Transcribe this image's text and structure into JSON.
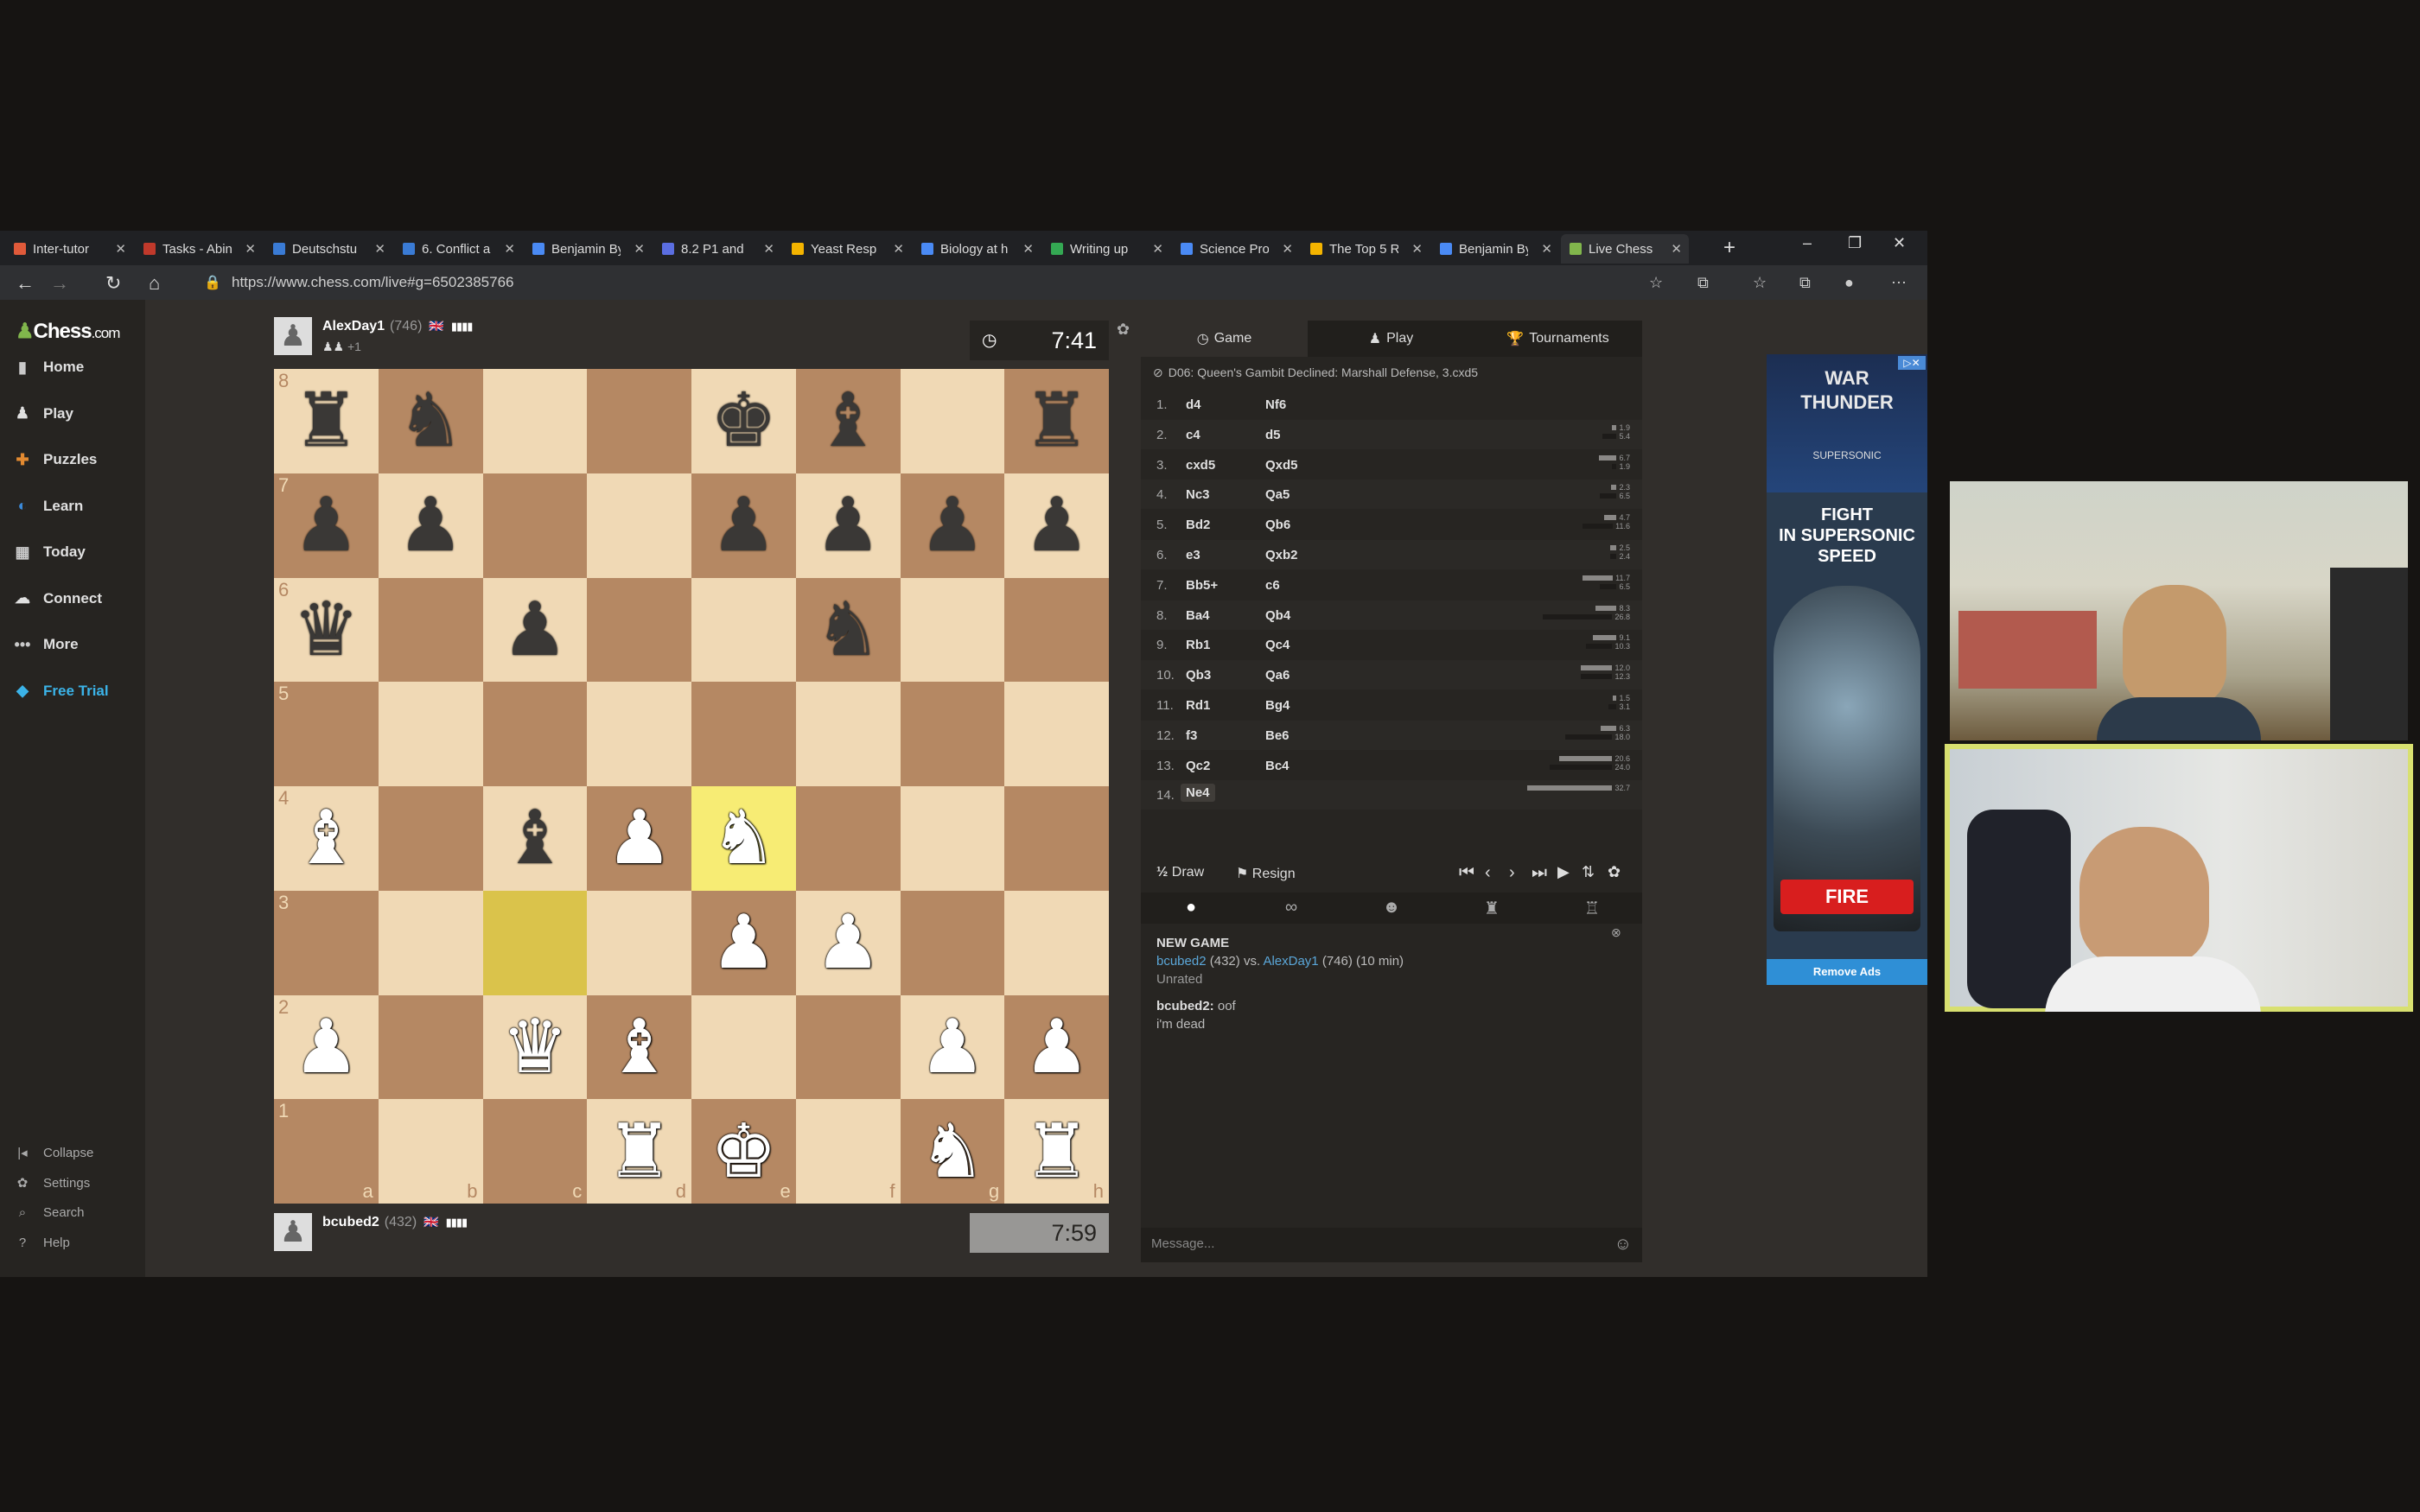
{
  "browser": {
    "tabs": [
      {
        "title": "Inter-tutor",
        "color": "#e05a3a",
        "active": false
      },
      {
        "title": "Tasks - Abin",
        "color": "#c0392b",
        "active": false
      },
      {
        "title": "Deutschstu",
        "color": "#3a7bd5",
        "active": false
      },
      {
        "title": "6. Conflict a",
        "color": "#3a7bd5",
        "active": false
      },
      {
        "title": "Benjamin By",
        "color": "#4a8af4",
        "active": false
      },
      {
        "title": "8.2 P1 and",
        "color": "#5b6ee1",
        "active": false
      },
      {
        "title": "Yeast Resp",
        "color": "#f4b400",
        "active": false
      },
      {
        "title": "Biology at h",
        "color": "#4a8af4",
        "active": false
      },
      {
        "title": "Writing up",
        "color": "#34a853",
        "active": false
      },
      {
        "title": "Science Proj",
        "color": "#4a8af4",
        "active": false
      },
      {
        "title": "The Top 5 R",
        "color": "#f4b400",
        "active": false
      },
      {
        "title": "Benjamin By",
        "color": "#4a8af4",
        "active": false
      },
      {
        "title": "Live Chess",
        "color": "#81b64c",
        "active": true
      }
    ],
    "url": "https://www.chess.com/live#g=6502385766",
    "new_tab": "+",
    "minimize": "–",
    "restore": "❐",
    "close": "✕"
  },
  "sidebar": {
    "logo_main": "Chess",
    "logo_suffix": ".com",
    "items": [
      {
        "label": "Home",
        "icon": "home-icon",
        "glyph": "▮",
        "color": "#c9c9c9"
      },
      {
        "label": "Play",
        "icon": "play-icon",
        "glyph": "♟",
        "color": "#e0e0e0"
      },
      {
        "label": "Puzzles",
        "icon": "puzzle-icon",
        "glyph": "✚",
        "color": "#e28a31"
      },
      {
        "label": "Learn",
        "icon": "learn-icon",
        "glyph": "◐",
        "color": "#3b8ad9"
      },
      {
        "label": "Today",
        "icon": "today-icon",
        "glyph": "▦",
        "color": "#c9c9c9"
      },
      {
        "label": "Connect",
        "icon": "connect-icon",
        "glyph": "☁",
        "color": "#e0e0e0"
      },
      {
        "label": "More",
        "icon": "more-icon",
        "glyph": "•••",
        "color": "#c9c9c9"
      },
      {
        "label": "Free Trial",
        "icon": "diamond-icon",
        "glyph": "◆",
        "color": "#3bb3e8"
      }
    ],
    "bottom": [
      {
        "label": "Collapse",
        "icon": "collapse-icon",
        "glyph": "|◂"
      },
      {
        "label": "Settings",
        "icon": "gear-icon",
        "glyph": "✿"
      },
      {
        "label": "Search",
        "icon": "search-icon",
        "glyph": "⌕"
      },
      {
        "label": "Help",
        "icon": "help-icon",
        "glyph": "?"
      }
    ]
  },
  "game": {
    "top_player": {
      "name": "AlexDay1",
      "rating": "(746)",
      "clock": "7:41",
      "captured": "+1"
    },
    "bottom_player": {
      "name": "bcubed2",
      "rating": "(432)",
      "clock": "7:59"
    },
    "flag": "🇬🇧",
    "bars": "▮▮▮▮",
    "board": [
      [
        "br",
        "bn",
        "",
        "",
        "bk",
        "bb",
        "",
        "br"
      ],
      [
        "bp",
        "bp",
        "",
        "",
        "bp",
        "bp",
        "bp",
        "bp"
      ],
      [
        "bq",
        "",
        "bp",
        "",
        "",
        "bn",
        "",
        ""
      ],
      [
        "",
        "",
        "",
        "",
        "",
        "",
        "",
        ""
      ],
      [
        "wb",
        "",
        "bb",
        "wp",
        "wn",
        "",
        "",
        ""
      ],
      [
        "",
        "",
        "",
        "",
        "wp",
        "wp",
        "",
        ""
      ],
      [
        "wp",
        "",
        "wq",
        "wb",
        "",
        "",
        "wp",
        "wp"
      ],
      [
        "",
        "",
        "",
        "wr",
        "wk",
        "",
        "wn",
        "wr"
      ]
    ],
    "highlights": [
      "e4",
      "c3"
    ],
    "ranks": [
      "8",
      "7",
      "6",
      "5",
      "4",
      "3",
      "2",
      "1"
    ],
    "files": [
      "a",
      "b",
      "c",
      "d",
      "e",
      "f",
      "g",
      "h"
    ]
  },
  "panel": {
    "tabs": [
      {
        "label": "Game",
        "icon": "clock-icon",
        "glyph": "◷"
      },
      {
        "label": "Play",
        "icon": "play-icon",
        "glyph": "♟"
      },
      {
        "label": "Tournaments",
        "icon": "trophy-icon",
        "glyph": "🏆"
      }
    ],
    "opening": "D06: Queen's Gambit Declined: Marshall Defense, 3.cxd5",
    "moves": [
      {
        "n": "1.",
        "w": "d4",
        "b": "Nf6",
        "tw": "",
        "tb": ""
      },
      {
        "n": "2.",
        "w": "c4",
        "b": "d5",
        "tw": "1.9",
        "tb": "5.4"
      },
      {
        "n": "3.",
        "w": "cxd5",
        "b": "Qxd5",
        "tw": "6.7",
        "tb": "1.9"
      },
      {
        "n": "4.",
        "w": "Nc3",
        "b": "Qa5",
        "tw": "2.3",
        "tb": "6.5"
      },
      {
        "n": "5.",
        "w": "Bd2",
        "b": "Qb6",
        "tw": "4.7",
        "tb": "11.6"
      },
      {
        "n": "6.",
        "w": "e3",
        "b": "Qxb2",
        "tw": "2.5",
        "tb": "2.4"
      },
      {
        "n": "7.",
        "w": "Bb5+",
        "b": "c6",
        "tw": "11.7",
        "tb": "6.5"
      },
      {
        "n": "8.",
        "w": "Ba4",
        "b": "Qb4",
        "tw": "8.3",
        "tb": "26.8"
      },
      {
        "n": "9.",
        "w": "Rb1",
        "b": "Qc4",
        "tw": "9.1",
        "tb": "10.3"
      },
      {
        "n": "10.",
        "w": "Qb3",
        "b": "Qa6",
        "tw": "12.0",
        "tb": "12.3"
      },
      {
        "n": "11.",
        "w": "Rd1",
        "b": "Bg4",
        "tw": "1.5",
        "tb": "3.1"
      },
      {
        "n": "12.",
        "w": "f3",
        "b": "Be6",
        "tw": "6.3",
        "tb": "18.0"
      },
      {
        "n": "13.",
        "w": "Qc2",
        "b": "Bc4",
        "tw": "20.6",
        "tb": "24.0"
      },
      {
        "n": "14.",
        "w": "Ne4",
        "b": "",
        "tw": "32.7",
        "tb": ""
      }
    ],
    "draw": "Draw",
    "resign": "Resign",
    "draw_icon": "½",
    "chat": {
      "heading": "NEW GAME",
      "p1": "bcubed2",
      "p1r": "(432)",
      "vs": "vs.",
      "p2": "AlexDay1",
      "p2r": "(746)",
      "tc": "(10 min)",
      "mode": "Unrated",
      "author": "bcubed2:",
      "msg1": "oof",
      "msg2": "i'm dead"
    },
    "message_placeholder": "Message..."
  },
  "ad": {
    "logo_line1": "WAR",
    "logo_line2": "THUNDER",
    "sub": "SUPERSONIC",
    "headline1": "FIGHT",
    "headline2": "IN SUPERSONIC",
    "headline3": "SPEED",
    "cta": "FIRE",
    "remove": "Remove Ads"
  }
}
